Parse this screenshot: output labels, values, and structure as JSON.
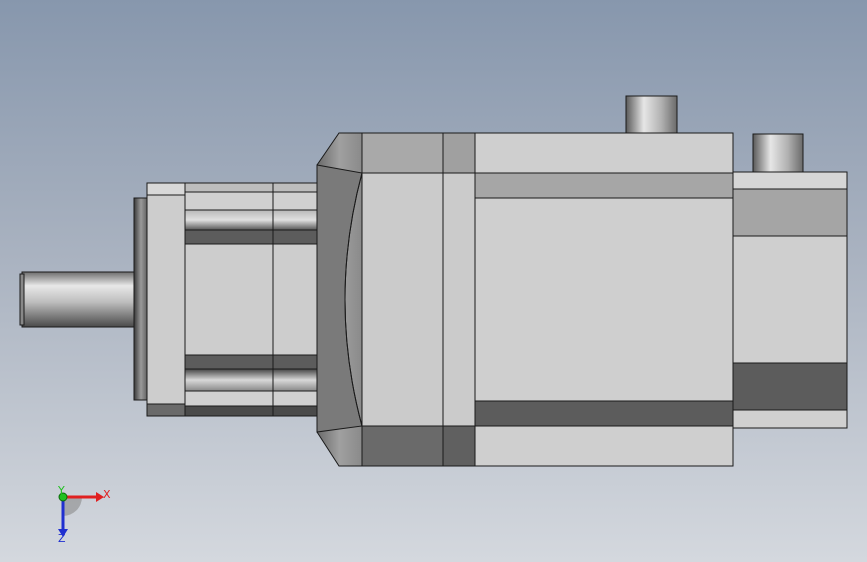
{
  "viewport": {
    "background_top": "#8797ad",
    "background_bottom": "#d4d8de"
  },
  "model": {
    "part_colors": {
      "body_light": "#cfcfcf",
      "body_mid": "#a8a8a8",
      "body_dark": "#5c5c5c",
      "edge": "#1a1a1a"
    }
  },
  "triad": {
    "x_label": "X",
    "y_label": "Y",
    "z_label": "Z",
    "x_color": "#e02020",
    "y_color": "#20c020",
    "z_color": "#2030d0"
  }
}
